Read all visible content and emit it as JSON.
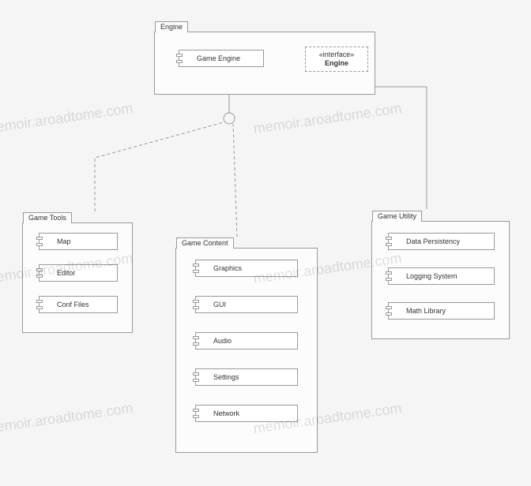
{
  "packages": {
    "engine": {
      "title": "Engine"
    },
    "tools": {
      "title": "Game Tools"
    },
    "content": {
      "title": "Game Content"
    },
    "utility": {
      "title": "Game Utility"
    }
  },
  "components": {
    "game_engine": "Game Engine",
    "map": "Map",
    "editor": "Editor",
    "conf": "Conf Files",
    "graphics": "Graphics",
    "gui": "GUI",
    "audio": "Audio",
    "settings": "Settings",
    "network": "Network",
    "persist": "Data Persistency",
    "logging": "Logging System",
    "math": "Math Library"
  },
  "interface": {
    "stereotype": "«interface»",
    "name": "Engine"
  },
  "watermark": "memoir.aroadtome.com"
}
